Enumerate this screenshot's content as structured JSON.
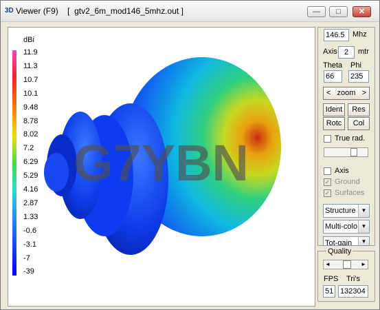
{
  "window": {
    "title": "Viewer (F9)    [  gtv2_6m_mod146_5mhz.out ]",
    "icon_text": "3D",
    "buttons": {
      "minimize": "—",
      "maximize": "□",
      "close": "✕"
    }
  },
  "legend": {
    "unit": "dBi",
    "values": [
      "11.9",
      "11.3",
      "10.7",
      "10.1",
      "9.48",
      "8.78",
      "8.02",
      "7.2",
      "6.29",
      "5.29",
      "4.16",
      "2.87",
      "1.33",
      "-0.6",
      "-3.1",
      "-7",
      "-39"
    ]
  },
  "watermark": "G7YBN",
  "controls": {
    "frequency_value": "146.5",
    "frequency_unit": "Mhz",
    "axis_label": "Axis",
    "axis_value": "2",
    "axis_unit": "mtr",
    "theta_label": "Theta",
    "phi_label": "Phi",
    "theta_value": "66",
    "phi_value": "235",
    "zoom_label": "zoom",
    "zoom_left": "<",
    "zoom_right": ">",
    "ident_label": "Ident",
    "res_label": "Res",
    "rotc_label": "Rotc",
    "col_label": "Col",
    "true_rad_label": "True rad.",
    "axis_check_label": "Axis",
    "ground_label": "Ground",
    "surfaces_label": "Surfaces",
    "structure_select": "Structure",
    "color_select": "Multi-colo",
    "gain_select": "Tot-gain",
    "quality_label": "Quality",
    "fps_label": "FPS",
    "tris_label": "Tri's",
    "fps_value": "51",
    "tris_value": "132304"
  }
}
